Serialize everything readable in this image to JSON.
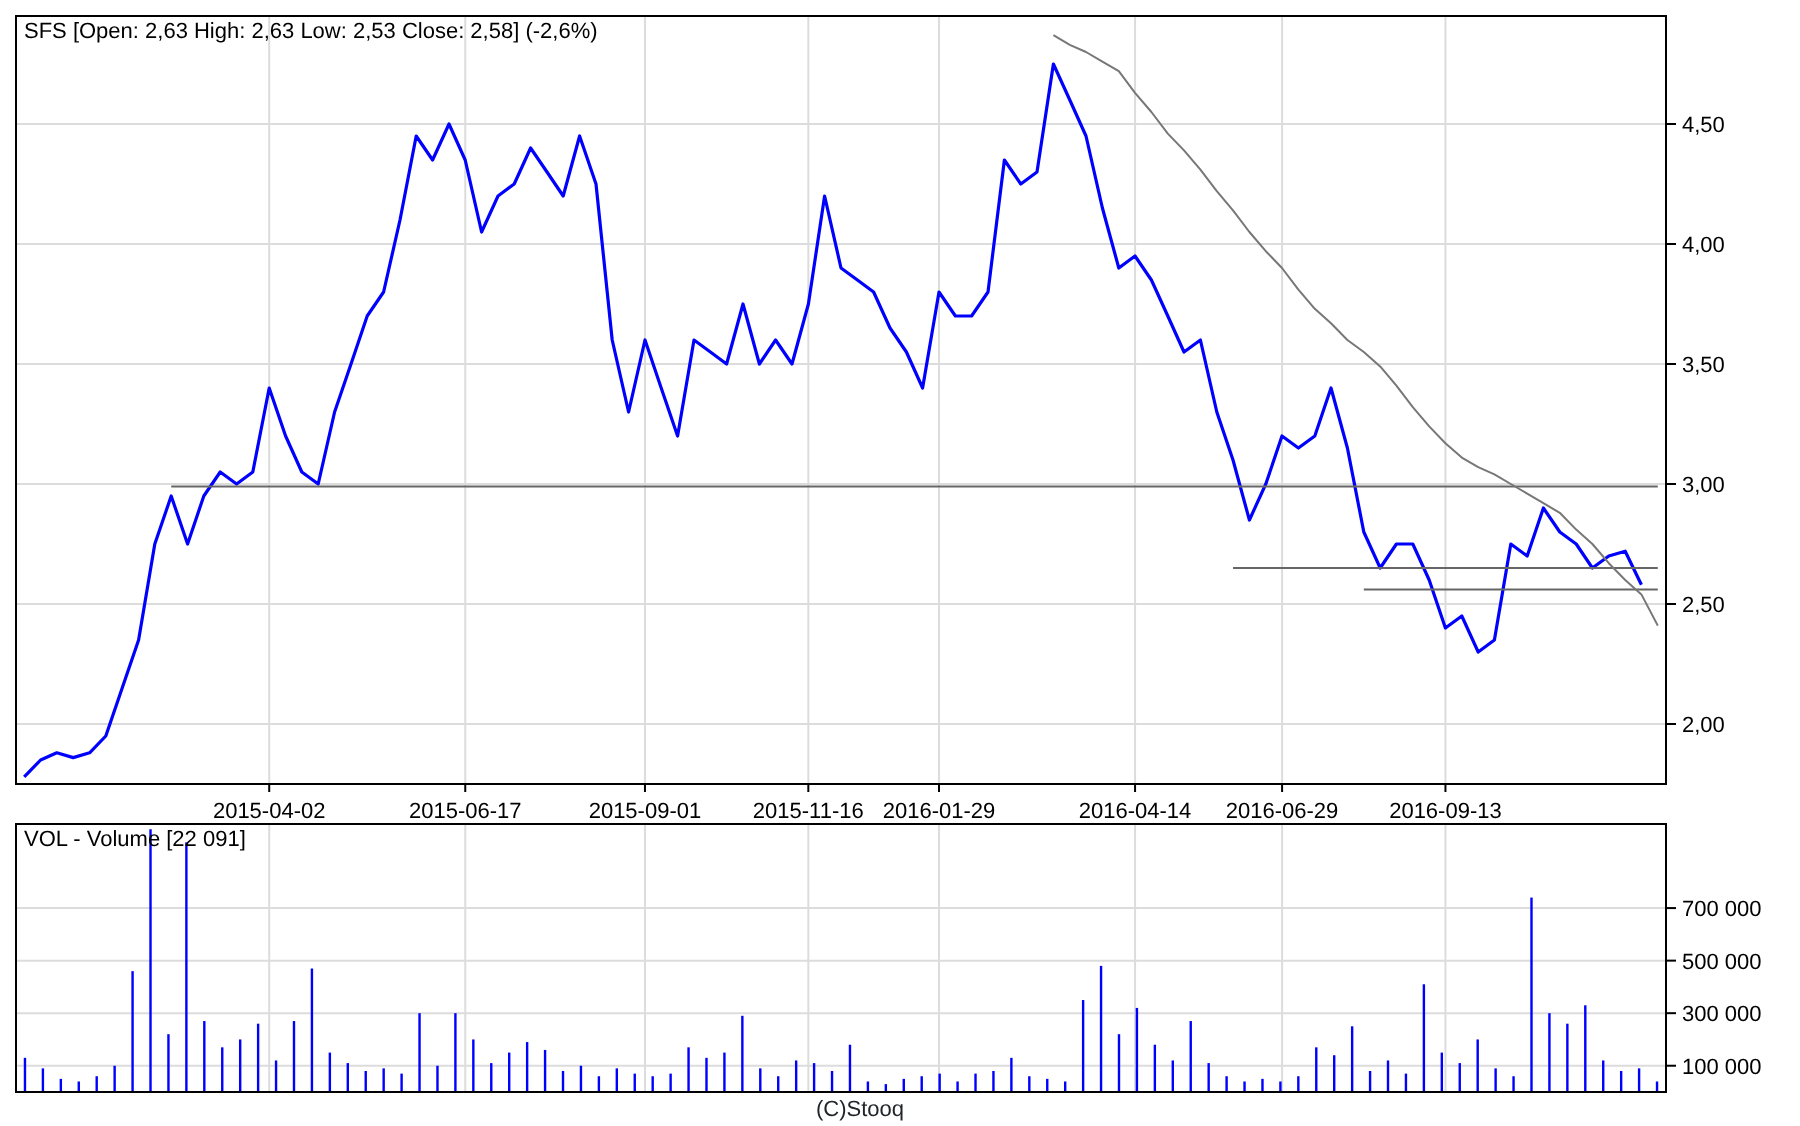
{
  "charts": [
    {
      "kind": "price",
      "chart_data": {
        "type": "line",
        "title": "SFS [Open: 2,63  High: 2,63  Low: 2,53  Close: 2,58] (-2,6%)",
        "ylim": [
          1.75,
          4.95
        ],
        "grid": true,
        "yticks": [
          {
            "value": 2,
            "label": "2,00"
          },
          {
            "value": 2.5,
            "label": "2,50"
          },
          {
            "value": 3,
            "label": "3,00"
          },
          {
            "value": 3.5,
            "label": "3,50"
          },
          {
            "value": 4,
            "label": "4,00"
          },
          {
            "value": 4.5,
            "label": "4,50"
          }
        ],
        "categories": [
          null,
          null,
          null,
          null,
          null,
          null,
          null,
          null,
          null,
          null,
          null,
          null,
          null,
          null,
          null,
          "2015-04-02",
          null,
          null,
          null,
          null,
          null,
          null,
          null,
          null,
          null,
          null,
          null,
          "2015-06-17",
          null,
          null,
          null,
          null,
          null,
          null,
          null,
          null,
          null,
          null,
          "2015-09-01",
          null,
          null,
          null,
          null,
          null,
          null,
          null,
          null,
          null,
          "2015-11-16",
          null,
          null,
          null,
          null,
          null,
          null,
          null,
          "2016-01-29",
          null,
          null,
          null,
          null,
          null,
          null,
          null,
          null,
          null,
          null,
          null,
          "2016-04-14",
          null,
          null,
          null,
          null,
          null,
          null,
          null,
          null,
          "2016-06-29",
          null,
          null,
          null,
          null,
          null,
          null,
          null,
          null,
          null,
          "2016-09-13",
          null,
          null,
          null,
          null,
          null,
          null,
          null,
          null,
          null,
          null,
          null,
          null,
          null
        ],
        "series": [
          {
            "color": "#0000ff",
            "values": [
              1.78,
              1.85,
              1.88,
              1.86,
              1.88,
              1.95,
              2.15,
              2.35,
              2.75,
              2.95,
              2.75,
              2.95,
              3.05,
              3.0,
              3.05,
              3.4,
              3.2,
              3.05,
              3.0,
              3.3,
              3.5,
              3.7,
              3.8,
              4.1,
              4.45,
              4.35,
              4.5,
              4.35,
              4.05,
              4.2,
              4.25,
              4.4,
              4.3,
              4.2,
              4.45,
              4.25,
              3.6,
              3.3,
              3.6,
              3.4,
              3.2,
              3.6,
              3.55,
              3.5,
              3.75,
              3.5,
              3.6,
              3.5,
              3.75,
              4.2,
              3.9,
              3.85,
              3.8,
              3.65,
              3.55,
              3.4,
              3.8,
              3.7,
              3.7,
              3.8,
              4.35,
              4.25,
              4.3,
              4.75,
              4.6,
              4.45,
              4.15,
              3.9,
              3.95,
              3.85,
              3.7,
              3.55,
              3.6,
              3.3,
              3.1,
              2.85,
              3.0,
              3.2,
              3.15,
              3.2,
              3.4,
              3.15,
              2.8,
              2.65,
              2.75,
              2.75,
              2.6,
              2.4,
              2.45,
              2.3,
              2.35,
              2.75,
              2.7,
              2.9,
              2.8,
              2.75,
              2.65,
              2.7,
              2.72,
              2.58,
              null
            ]
          },
          {
            "color": "#666666",
            "values": [
              null,
              null,
              null,
              null,
              null,
              null,
              null,
              null,
              null,
              2.99,
              2.99,
              2.99,
              2.99,
              2.99,
              2.99,
              2.99,
              2.99,
              2.99,
              2.99,
              2.99,
              2.99,
              2.99,
              2.99,
              2.99,
              2.99,
              2.99,
              2.99,
              2.99,
              2.99,
              2.99,
              2.99,
              2.99,
              2.99,
              2.99,
              2.99,
              2.99,
              2.99,
              2.99,
              2.99,
              2.99,
              2.99,
              2.99,
              2.99,
              2.99,
              2.99,
              2.99,
              2.99,
              2.99,
              2.99,
              2.99,
              2.99,
              2.99,
              2.99,
              2.99,
              2.99,
              2.99,
              2.99,
              2.99,
              2.99,
              2.99,
              2.99,
              2.99,
              2.99,
              2.99,
              2.99,
              2.99,
              2.99,
              2.99,
              2.99,
              2.99,
              2.99,
              2.99,
              2.99,
              2.99,
              2.99,
              2.99,
              2.99,
              2.99,
              2.99,
              2.99,
              2.99,
              2.99,
              2.99,
              2.99,
              2.99,
              2.99,
              2.99,
              2.99,
              2.99,
              2.99,
              2.99,
              2.99,
              2.99,
              2.99,
              2.99,
              2.99,
              2.99,
              2.99,
              2.99,
              2.99,
              2.99
            ]
          },
          {
            "color": "#666666",
            "values": [
              null,
              null,
              null,
              null,
              null,
              null,
              null,
              null,
              null,
              null,
              null,
              null,
              null,
              null,
              null,
              null,
              null,
              null,
              null,
              null,
              null,
              null,
              null,
              null,
              null,
              null,
              null,
              null,
              null,
              null,
              null,
              null,
              null,
              null,
              null,
              null,
              null,
              null,
              null,
              null,
              null,
              null,
              null,
              null,
              null,
              null,
              null,
              null,
              null,
              null,
              null,
              null,
              null,
              null,
              null,
              null,
              null,
              null,
              null,
              null,
              null,
              null,
              null,
              null,
              null,
              null,
              null,
              null,
              null,
              null,
              null,
              null,
              null,
              null,
              2.65,
              2.65,
              2.65,
              2.65,
              2.65,
              2.65,
              2.65,
              2.65,
              2.65,
              2.65,
              2.65,
              2.65,
              2.65,
              2.65,
              2.65,
              2.65,
              2.65,
              2.65,
              2.65,
              2.65,
              2.65,
              2.65,
              2.65,
              2.65,
              2.65,
              2.65,
              2.65
            ]
          },
          {
            "color": "#666666",
            "values": [
              null,
              null,
              null,
              null,
              null,
              null,
              null,
              null,
              null,
              null,
              null,
              null,
              null,
              null,
              null,
              null,
              null,
              null,
              null,
              null,
              null,
              null,
              null,
              null,
              null,
              null,
              null,
              null,
              null,
              null,
              null,
              null,
              null,
              null,
              null,
              null,
              null,
              null,
              null,
              null,
              null,
              null,
              null,
              null,
              null,
              null,
              null,
              null,
              null,
              null,
              null,
              null,
              null,
              null,
              null,
              null,
              null,
              null,
              null,
              null,
              null,
              null,
              null,
              null,
              null,
              null,
              null,
              null,
              null,
              null,
              null,
              null,
              null,
              null,
              null,
              null,
              null,
              null,
              null,
              null,
              null,
              null,
              2.56,
              2.56,
              2.56,
              2.56,
              2.56,
              2.56,
              2.56,
              2.56,
              2.56,
              2.56,
              2.56,
              2.56,
              2.56,
              2.56,
              2.56,
              2.56,
              2.56,
              2.56,
              2.56
            ]
          },
          {
            "color": "#777777",
            "values": [
              null,
              null,
              null,
              null,
              null,
              null,
              null,
              null,
              null,
              null,
              null,
              null,
              null,
              null,
              null,
              null,
              null,
              null,
              null,
              null,
              null,
              null,
              null,
              null,
              null,
              null,
              null,
              null,
              null,
              null,
              null,
              null,
              null,
              null,
              null,
              null,
              null,
              null,
              null,
              null,
              null,
              null,
              null,
              null,
              null,
              null,
              null,
              null,
              null,
              null,
              null,
              null,
              null,
              null,
              null,
              null,
              null,
              null,
              null,
              null,
              null,
              null,
              null,
              4.87,
              4.83,
              4.8,
              4.76,
              4.72,
              4.63,
              4.55,
              4.46,
              4.39,
              4.31,
              4.22,
              4.14,
              4.05,
              3.97,
              3.9,
              3.81,
              3.73,
              3.67,
              3.6,
              3.55,
              3.49,
              3.41,
              3.32,
              3.24,
              3.17,
              3.11,
              3.07,
              3.04,
              3.0,
              2.96,
              2.92,
              2.88,
              2.81,
              2.75,
              2.67,
              2.6,
              2.54,
              2.41
            ]
          }
        ]
      }
    },
    {
      "kind": "volume",
      "chart_data": {
        "type": "bar",
        "title": "VOL - Volume [22 091]",
        "ylim": [
          0,
          1020000
        ],
        "grid": true,
        "yticks": [
          {
            "value": 100000,
            "label": "100 000"
          },
          {
            "value": 300000,
            "label": "300 000"
          },
          {
            "value": 500000,
            "label": "500 000"
          },
          {
            "value": 700000,
            "label": "700 000"
          }
        ],
        "categories": [
          null,
          null,
          null,
          null,
          null,
          null,
          null,
          null,
          null,
          null,
          null,
          null,
          null,
          null,
          null,
          null,
          null,
          null,
          null,
          null,
          null,
          null,
          null,
          null,
          null,
          null,
          null,
          null,
          null,
          null,
          null,
          null,
          null,
          null,
          null,
          null,
          null,
          null,
          null,
          null,
          null,
          null,
          null,
          null,
          null,
          null,
          null,
          null,
          null,
          null,
          null,
          null,
          null,
          null,
          null,
          null,
          null,
          null,
          null,
          null,
          null,
          null,
          null,
          null,
          null,
          null,
          null,
          null,
          null,
          null,
          null,
          null,
          null,
          null,
          null,
          null,
          null,
          null,
          null,
          null,
          null,
          null,
          null,
          null,
          null,
          null,
          null,
          null,
          null,
          null,
          null,
          null
        ],
        "series": [
          {
            "color": "#0000ff",
            "values": [
              130000,
              90000,
              50000,
              40000,
              60000,
              100000,
              460000,
              1000000,
              220000,
              950000,
              270000,
              170000,
              200000,
              260000,
              120000,
              270000,
              470000,
              150000,
              110000,
              80000,
              90000,
              70000,
              300000,
              100000,
              300000,
              200000,
              110000,
              150000,
              190000,
              160000,
              80000,
              100000,
              60000,
              90000,
              70000,
              60000,
              70000,
              170000,
              130000,
              150000,
              290000,
              90000,
              60000,
              120000,
              110000,
              80000,
              180000,
              40000,
              30000,
              50000,
              60000,
              70000,
              40000,
              70000,
              80000,
              130000,
              60000,
              50000,
              40000,
              350000,
              480000,
              220000,
              320000,
              180000,
              120000,
              270000,
              110000,
              60000,
              40000,
              50000,
              40000,
              60000,
              170000,
              140000,
              250000,
              80000,
              120000,
              70000,
              410000,
              150000,
              110000,
              200000,
              90000,
              60000,
              740000,
              300000,
              260000,
              330000,
              120000,
              80000,
              90000,
              40000
            ]
          }
        ]
      }
    }
  ],
  "footer": "(C)Stooq"
}
